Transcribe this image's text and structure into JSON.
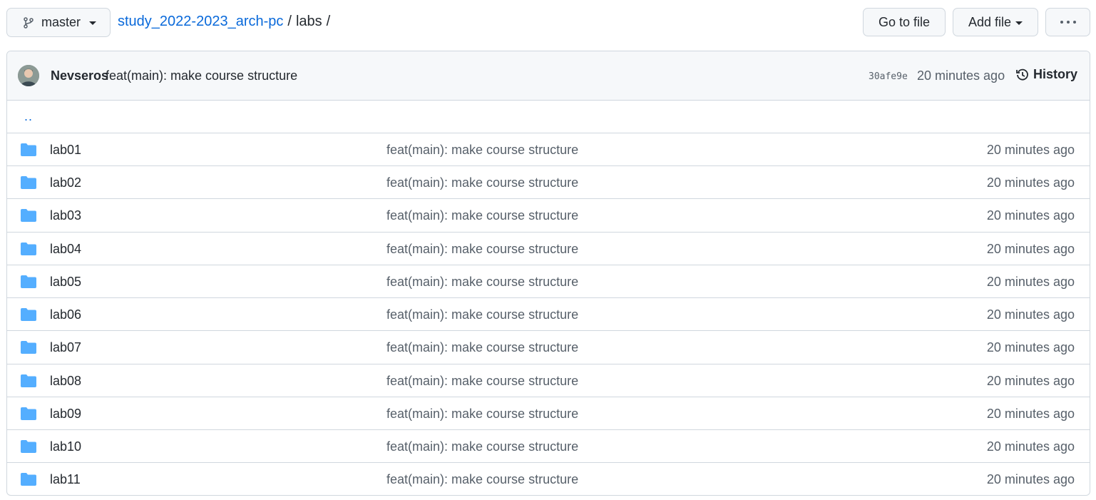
{
  "toolbar": {
    "branch": "master",
    "breadcrumb": {
      "repo": "study_2022-2023_arch-pc",
      "separator": "/",
      "current": "labs",
      "trailing": "/"
    },
    "go_to_file": "Go to file",
    "add_file": "Add file",
    "more": "···"
  },
  "latest_commit": {
    "author": "Nevseros",
    "message": "feat(main): make course structure",
    "sha": "30afe9e",
    "time": "20 minutes ago",
    "history_label": "History"
  },
  "parent_link": "..",
  "colors": {
    "link": "#0969da",
    "folder": "#54aeff",
    "border": "#d0d7de",
    "muted": "#57606a"
  },
  "files": [
    {
      "name": "lab01",
      "icon": "folder-icon",
      "message": "feat(main): make course structure",
      "age": "20 minutes ago"
    },
    {
      "name": "lab02",
      "icon": "folder-icon",
      "message": "feat(main): make course structure",
      "age": "20 minutes ago"
    },
    {
      "name": "lab03",
      "icon": "folder-icon",
      "message": "feat(main): make course structure",
      "age": "20 minutes ago"
    },
    {
      "name": "lab04",
      "icon": "folder-icon",
      "message": "feat(main): make course structure",
      "age": "20 minutes ago"
    },
    {
      "name": "lab05",
      "icon": "folder-icon",
      "message": "feat(main): make course structure",
      "age": "20 minutes ago"
    },
    {
      "name": "lab06",
      "icon": "folder-icon",
      "message": "feat(main): make course structure",
      "age": "20 minutes ago"
    },
    {
      "name": "lab07",
      "icon": "folder-icon",
      "message": "feat(main): make course structure",
      "age": "20 minutes ago"
    },
    {
      "name": "lab08",
      "icon": "folder-icon",
      "message": "feat(main): make course structure",
      "age": "20 minutes ago"
    },
    {
      "name": "lab09",
      "icon": "folder-icon",
      "message": "feat(main): make course structure",
      "age": "20 minutes ago"
    },
    {
      "name": "lab10",
      "icon": "folder-icon",
      "message": "feat(main): make course structure",
      "age": "20 minutes ago"
    },
    {
      "name": "lab11",
      "icon": "folder-icon",
      "message": "feat(main): make course structure",
      "age": "20 minutes ago"
    }
  ]
}
